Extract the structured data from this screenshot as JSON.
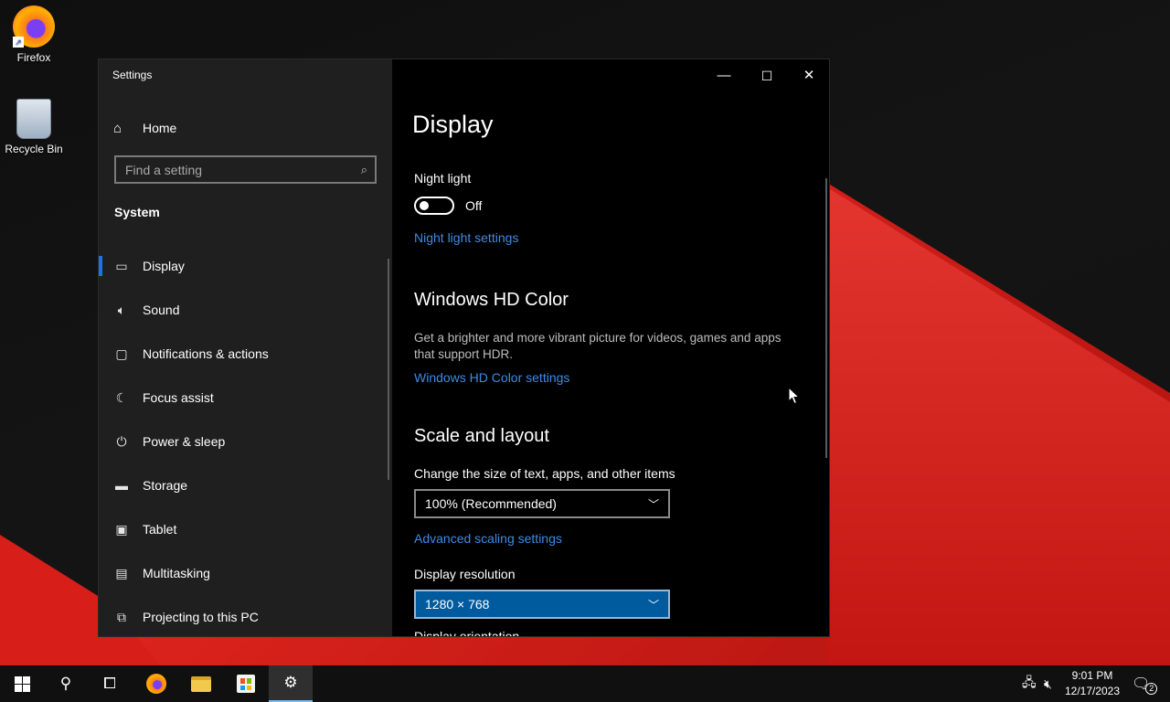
{
  "desktop": {
    "icons": [
      {
        "label": "Firefox",
        "icon": "firefox-icon"
      },
      {
        "label": "Recycle Bin",
        "icon": "recycle-bin-icon"
      }
    ],
    "wallpaper_colors": [
      "#111111",
      "#e8241d",
      "#ff4d3f"
    ]
  },
  "window": {
    "title": "Settings",
    "controls": {
      "minimize": "—",
      "maximize": "☐",
      "close": "✕"
    },
    "accent": "#1a73e8"
  },
  "sidebar": {
    "home_label": "Home",
    "search_placeholder": "Find a setting",
    "section": "System",
    "items": [
      {
        "label": "Display",
        "icon": "monitor-icon",
        "active": true
      },
      {
        "label": "Sound",
        "icon": "speaker-icon"
      },
      {
        "label": "Notifications & actions",
        "icon": "notification-icon"
      },
      {
        "label": "Focus assist",
        "icon": "moon-icon"
      },
      {
        "label": "Power & sleep",
        "icon": "power-icon"
      },
      {
        "label": "Storage",
        "icon": "storage-icon"
      },
      {
        "label": "Tablet",
        "icon": "tablet-icon"
      },
      {
        "label": "Multitasking",
        "icon": "multitasking-icon"
      },
      {
        "label": "Projecting to this PC",
        "icon": "projector-icon"
      }
    ]
  },
  "content": {
    "title": "Display",
    "night_light": {
      "label": "Night light",
      "state": "Off",
      "link": "Night light settings"
    },
    "hd_color": {
      "heading": "Windows HD Color",
      "description_line1": "Get a brighter and more vibrant picture for videos, games and apps",
      "description_line2": "that support HDR.",
      "link": "Windows HD Color settings"
    },
    "scale_layout": {
      "heading": "Scale and layout",
      "size_label": "Change the size of text, apps, and other items",
      "size_value": "100% (Recommended)",
      "advanced_link": "Advanced scaling settings",
      "resolution_label": "Display resolution",
      "resolution_value": "1280 × 768",
      "orientation_label": "Display orientation"
    }
  },
  "taskbar": {
    "buttons": [
      {
        "name": "start",
        "icon": "windows-logo-icon"
      },
      {
        "name": "search",
        "icon": "search-icon"
      },
      {
        "name": "task-view",
        "icon": "task-view-icon"
      },
      {
        "name": "firefox",
        "icon": "firefox-icon"
      },
      {
        "name": "file-explorer",
        "icon": "folder-icon"
      },
      {
        "name": "store",
        "icon": "store-icon"
      },
      {
        "name": "settings",
        "icon": "gear-icon",
        "active": true
      }
    ],
    "time": "9:01 PM",
    "date": "12/17/2023",
    "notification_count": "2"
  }
}
